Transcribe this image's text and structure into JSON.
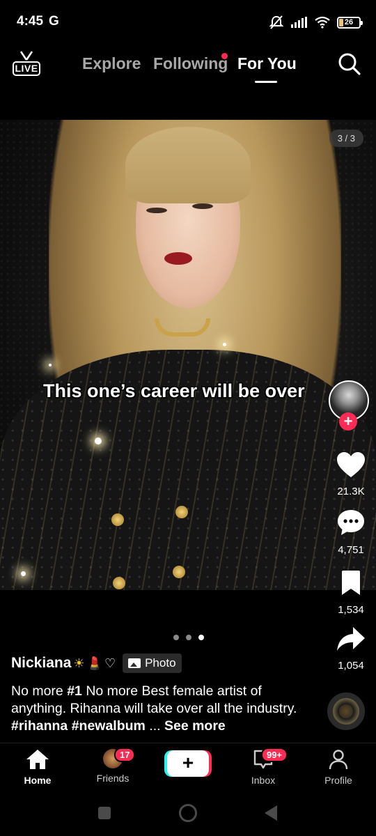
{
  "status_bar": {
    "time": "4:45",
    "carrier_icon": "G",
    "battery": "26"
  },
  "top_nav": {
    "live_label": "LIVE",
    "tabs": [
      {
        "label": "Explore",
        "active": false
      },
      {
        "label": "Following",
        "active": false,
        "has_dot": true
      },
      {
        "label": "For You",
        "active": true
      }
    ]
  },
  "post": {
    "counter": "3 / 3",
    "caption_overlay": "This one’s career will be over",
    "author": "Nickiana",
    "author_emojis": [
      "☀",
      "💄",
      "♡"
    ],
    "photo_tag": "Photo",
    "description_parts": [
      {
        "text": "No more ",
        "bold": false
      },
      {
        "text": "#1",
        "bold": true
      },
      {
        "text": " No more Best female artist of anything. Rihanna will take over all the industry. ",
        "bold": false
      },
      {
        "text": "#rihanna #newalbum",
        "bold": true
      },
      {
        "text": " ... ",
        "bold": false
      },
      {
        "text": "See more",
        "bold": true
      }
    ],
    "slides_total": 3,
    "slide_active": 3
  },
  "actions": {
    "likes": "21.3K",
    "comments": "4,751",
    "saves": "1,534",
    "shares": "1,054"
  },
  "bottom_nav": {
    "home": "Home",
    "friends": "Friends",
    "friends_badge": "17",
    "create": "+",
    "inbox": "Inbox",
    "inbox_badge": "99+",
    "profile": "Profile"
  },
  "colors": {
    "accent": "#fe2c55",
    "cyan": "#25f4ee"
  }
}
